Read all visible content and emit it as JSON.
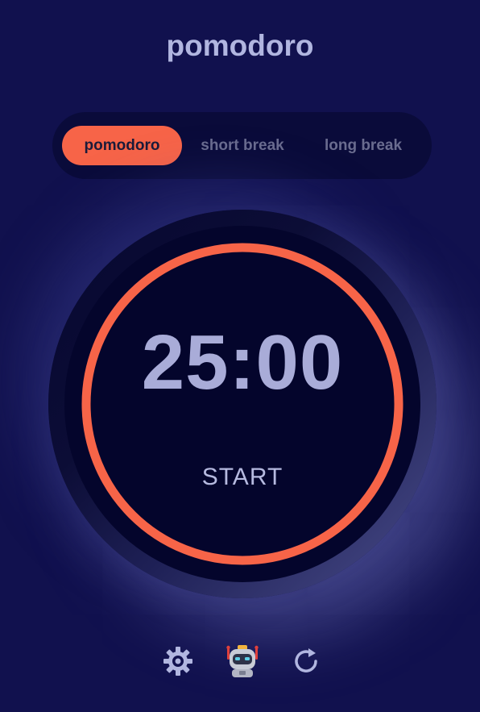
{
  "app": {
    "title": "pomodoro"
  },
  "tabs": [
    {
      "label": "pomodoro",
      "active": true
    },
    {
      "label": "short break",
      "active": false
    },
    {
      "label": "long break",
      "active": false
    }
  ],
  "timer": {
    "time": "25:00",
    "action_label": "START",
    "progress_fraction": 1.0
  },
  "footer": {
    "icons": [
      "gear-icon",
      "robot-icon",
      "refresh-icon"
    ]
  },
  "colors": {
    "background": "#11114e",
    "accent": "#f76448",
    "text": "#b1b6e0",
    "dial": "#04052c"
  }
}
